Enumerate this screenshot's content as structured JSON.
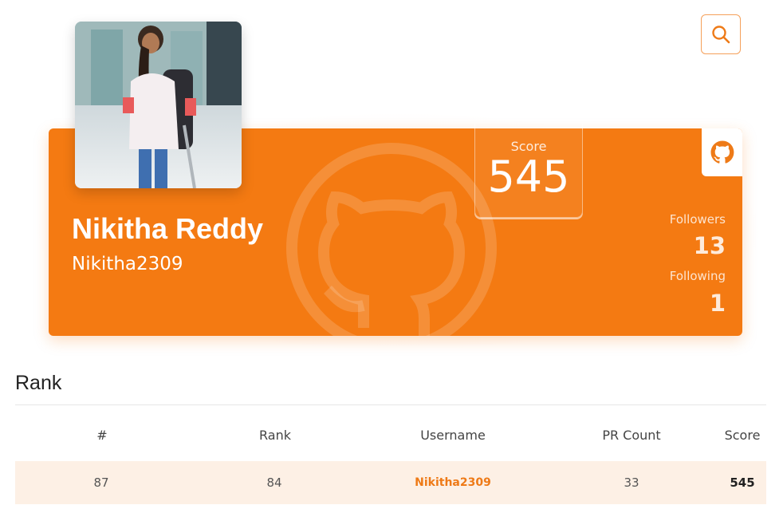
{
  "header": {
    "search_icon": "search-icon"
  },
  "profile": {
    "name": "Nikitha Reddy",
    "username": "Nikitha2309",
    "score_label": "Score",
    "score_value": "545",
    "followers_label": "Followers",
    "followers_count": "13",
    "following_label": "Following",
    "following_count": "1",
    "github_icon": "github-icon",
    "accent_color": "#f47a12"
  },
  "rank_section": {
    "title": "Rank",
    "columns": [
      "#",
      "Rank",
      "Username",
      "PR Count",
      "Score"
    ],
    "rows": [
      {
        "index": "87",
        "rank": "84",
        "username": "Nikitha2309",
        "pr_count": "33",
        "score": "545"
      }
    ]
  }
}
